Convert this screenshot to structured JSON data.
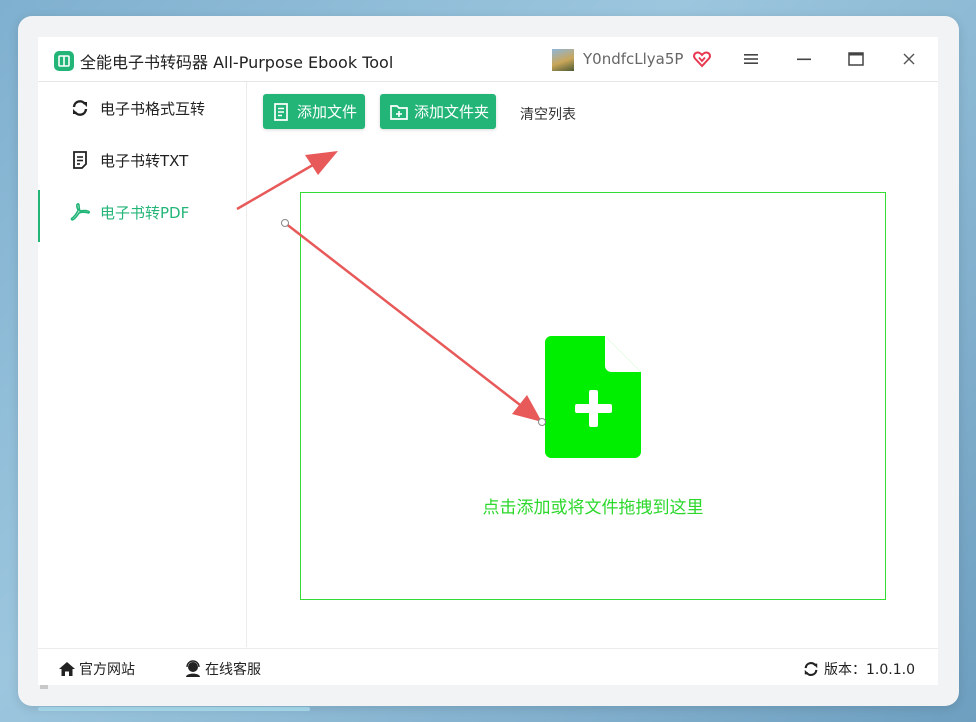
{
  "window": {
    "title": "全能电子书转码器 All-Purpose Ebook Tool",
    "username": "Y0ndfcLlya5P"
  },
  "sidebar": {
    "items": [
      {
        "label": "电子书格式互转",
        "icon": "refresh-icon"
      },
      {
        "label": "电子书转TXT",
        "icon": "document-icon"
      },
      {
        "label": "电子书转PDF",
        "icon": "pdf-icon",
        "active": true
      }
    ]
  },
  "toolbar": {
    "add_file_label": "添加文件",
    "add_folder_label": "添加文件夹",
    "clear_label": "清空列表"
  },
  "dropzone": {
    "hint": "点击添加或将文件拖拽到这里"
  },
  "statusbar": {
    "website_label": "官方网站",
    "support_label": "在线客服",
    "version_label": "版本：1.0.1.0"
  },
  "colors": {
    "accent": "#23b578",
    "dropzone": "#33dd33",
    "annotation": "#e85a5a"
  }
}
